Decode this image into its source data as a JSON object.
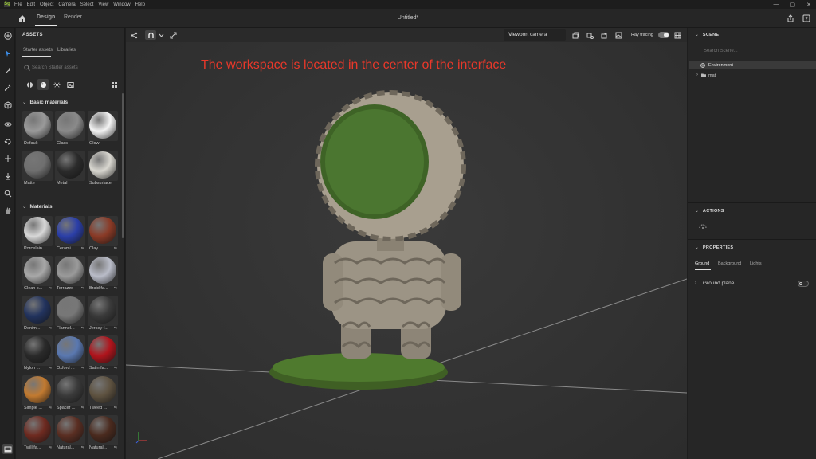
{
  "menu": {
    "logo": "Sg",
    "items": [
      "File",
      "Edit",
      "Object",
      "Camera",
      "Select",
      "View",
      "Window",
      "Help"
    ]
  },
  "window_controls": [
    "—",
    "▢",
    "✕"
  ],
  "topbar": {
    "tabs": [
      "Design",
      "Render"
    ],
    "active_tab": "Design",
    "document_title": "Untitled*"
  },
  "left_tools": [
    "add-icon",
    "select-icon",
    "magic-wand-icon",
    "eyedropper-icon",
    "3d-box-icon",
    "orbit-icon",
    "rotate-icon",
    "move-icon",
    "drop-to-floor-icon",
    "zoom-icon",
    "pan-icon",
    "bottom-panel-icon"
  ],
  "assets": {
    "title": "ASSETS",
    "tabs": [
      "Starter assets",
      "Libraries"
    ],
    "search_placeholder": "Search Starter assets",
    "basic_section": "Basic materials",
    "basic_materials": [
      {
        "name": "Default",
        "color": "#9a9a9a"
      },
      {
        "name": "Glass",
        "color": "#8a8a8a"
      },
      {
        "name": "Glow",
        "color": "#f4f4f4"
      },
      {
        "name": "Matte",
        "color": "#6f6f6f"
      },
      {
        "name": "Metal",
        "color": "#2b2b2b"
      },
      {
        "name": "Subsurface",
        "color": "#d9d7d0"
      }
    ],
    "materials_section": "Materials",
    "materials": [
      {
        "name": "Porcelain",
        "color": "#d8d8d8"
      },
      {
        "name": "Cerami...",
        "color": "#2b3fa8"
      },
      {
        "name": "Clay",
        "color": "#8a3a26"
      },
      {
        "name": "Clean c...",
        "color": "#a8a8a8"
      },
      {
        "name": "Terrazzo",
        "color": "#9a9a9a"
      },
      {
        "name": "Braid fa...",
        "color": "#b9bcc8"
      },
      {
        "name": "Denim ...",
        "color": "#22335e"
      },
      {
        "name": "Flannel...",
        "color": "#777777"
      },
      {
        "name": "Jersey f...",
        "color": "#3a3a3a"
      },
      {
        "name": "Nylon ...",
        "color": "#2a2a2a"
      },
      {
        "name": "Oxford ...",
        "color": "#5a78b0"
      },
      {
        "name": "Satin fa...",
        "color": "#b0141c"
      },
      {
        "name": "Simple ...",
        "color": "#c27a30"
      },
      {
        "name": "Spacer ...",
        "color": "#3a3a3a"
      },
      {
        "name": "Tweed ...",
        "color": "#5e5240"
      },
      {
        "name": "Twill fa...",
        "color": "#6e2a20"
      },
      {
        "name": "Natural...",
        "color": "#5a2e22"
      },
      {
        "name": "Natural...",
        "color": "#4a2a1e"
      }
    ]
  },
  "viewport": {
    "camera": "Viewport camera",
    "ray_tracing_label": "Ray tracing",
    "ray_tracing_on": true,
    "annotation": "The workspace is located in the center of the interface"
  },
  "scene": {
    "title": "SCENE",
    "search_placeholder": "Search Scene...",
    "items": [
      "Environment",
      "mat"
    ]
  },
  "actions": {
    "title": "ACTIONS"
  },
  "properties": {
    "title": "PROPERTIES",
    "tabs": [
      "Ground",
      "Background",
      "Lights"
    ],
    "ground_plane_label": "Ground plane",
    "ground_plane_on": false
  }
}
